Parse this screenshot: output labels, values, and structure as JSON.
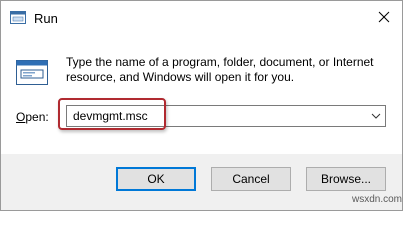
{
  "window": {
    "title": "Run"
  },
  "dialog": {
    "description": "Type the name of a program, folder, document, or Internet resource, and Windows will open it for you.",
    "open_label_prefix": "",
    "open_label_mnemonic": "O",
    "open_label_rest": "pen:",
    "open_value": "devmgmt.msc"
  },
  "buttons": {
    "ok": "OK",
    "cancel": "Cancel",
    "browse": "Browse..."
  },
  "icons": {
    "app": "run-icon",
    "close": "close-icon",
    "dropdown": "chevron-down-icon"
  },
  "colors": {
    "highlight": "#b02a30",
    "primary_border": "#0078d7",
    "footer_bg": "#f0f0f0"
  },
  "watermark": "wsxdn.com"
}
